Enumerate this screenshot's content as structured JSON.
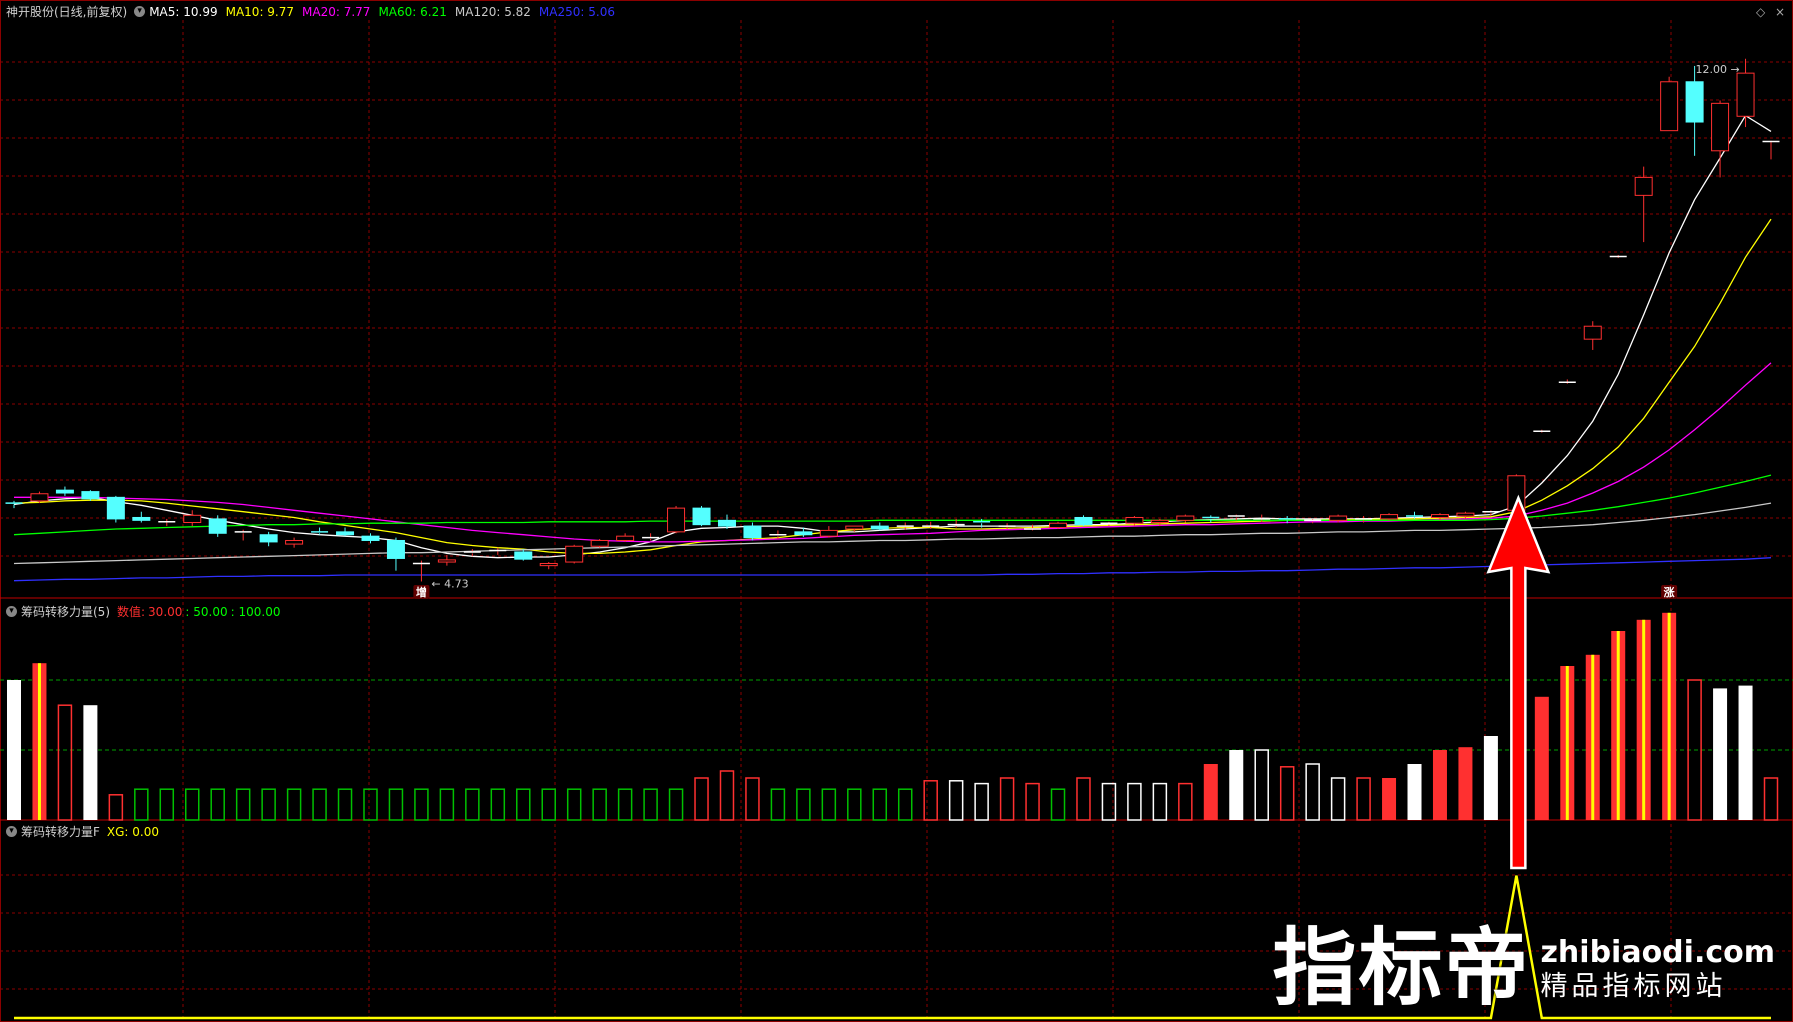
{
  "header": {
    "stock_label": "神开股份(日线,前复权)",
    "ma_items": [
      {
        "label": "MA5: 10.99",
        "color": "#ffffff"
      },
      {
        "label": "MA10: 9.77",
        "color": "#ffff00"
      },
      {
        "label": "MA20: 7.77",
        "color": "#ff00ff"
      },
      {
        "label": "MA60: 6.21",
        "color": "#00ff00"
      },
      {
        "label": "MA120: 5.82",
        "color": "#c8c8c8"
      },
      {
        "label": "MA250: 5.06",
        "color": "#3030ff"
      }
    ]
  },
  "panel2": {
    "title": "筹码转移力量(5)",
    "value_label": "数值:",
    "values": [
      {
        "text": "30.00",
        "color": "#ff3030"
      },
      {
        "text": ": 50.00",
        "color": "#00ff00"
      },
      {
        "text": ": 100.00",
        "color": "#00ff00"
      }
    ]
  },
  "panel3": {
    "title": "筹码转移力量F",
    "xg_label": "XG: 0.00"
  },
  "annotations": {
    "low_price": "4.73",
    "high_price": "12.00",
    "marker_left": "增",
    "marker_right": "涨"
  },
  "watermark": {
    "big": "指标帝",
    "domain": "zhibiaodi.com",
    "sub": "精品指标网站"
  },
  "colors": {
    "grid": "#8b0000",
    "up": "#ff3030",
    "down": "#54ffff",
    "bar_white": "#ffffff",
    "bar_green": "#00c000",
    "bar_yellow": "#ffff00",
    "arrow": "#ff0000"
  },
  "chart_data": [
    {
      "type": "candlestick",
      "title": "神开股份(日线,前复权)",
      "ylim": [
        4.5,
        12.4
      ],
      "ohlc": [
        [
          5.82,
          5.85,
          5.75,
          5.8
        ],
        [
          5.85,
          5.98,
          5.82,
          5.95
        ],
        [
          6.0,
          6.05,
          5.92,
          5.96
        ],
        [
          5.98,
          6.0,
          5.85,
          5.88
        ],
        [
          5.9,
          5.92,
          5.55,
          5.6
        ],
        [
          5.62,
          5.7,
          5.55,
          5.58
        ],
        [
          5.55,
          5.6,
          5.5,
          5.56
        ],
        [
          5.55,
          5.72,
          5.5,
          5.65
        ],
        [
          5.6,
          5.65,
          5.35,
          5.4
        ],
        [
          5.4,
          5.45,
          5.3,
          5.42
        ],
        [
          5.38,
          5.42,
          5.22,
          5.28
        ],
        [
          5.25,
          5.34,
          5.2,
          5.3
        ],
        [
          5.42,
          5.48,
          5.38,
          5.4
        ],
        [
          5.42,
          5.48,
          5.36,
          5.38
        ],
        [
          5.36,
          5.4,
          5.26,
          5.3
        ],
        [
          5.3,
          5.34,
          4.88,
          5.05
        ],
        [
          4.98,
          5.02,
          4.73,
          4.98
        ],
        [
          5.0,
          5.1,
          4.95,
          5.03
        ],
        [
          5.12,
          5.18,
          5.08,
          5.14
        ],
        [
          5.15,
          5.2,
          5.1,
          5.16
        ],
        [
          5.14,
          5.18,
          5.02,
          5.04
        ],
        [
          4.95,
          5.0,
          4.9,
          4.98
        ],
        [
          5.0,
          5.24,
          4.98,
          5.22
        ],
        [
          5.22,
          5.32,
          5.2,
          5.3
        ],
        [
          5.3,
          5.4,
          5.28,
          5.36
        ],
        [
          5.32,
          5.4,
          5.3,
          5.34
        ],
        [
          5.42,
          5.78,
          5.4,
          5.75
        ],
        [
          5.75,
          5.78,
          5.5,
          5.52
        ],
        [
          5.58,
          5.66,
          5.46,
          5.5
        ],
        [
          5.5,
          5.55,
          5.3,
          5.34
        ],
        [
          5.36,
          5.44,
          5.32,
          5.38
        ],
        [
          5.42,
          5.48,
          5.35,
          5.38
        ],
        [
          5.36,
          5.5,
          5.34,
          5.44
        ],
        [
          5.46,
          5.5,
          5.42,
          5.5
        ],
        [
          5.5,
          5.55,
          5.44,
          5.46
        ],
        [
          5.48,
          5.55,
          5.45,
          5.5
        ],
        [
          5.5,
          5.56,
          5.46,
          5.5
        ],
        [
          5.5,
          5.6,
          5.48,
          5.52
        ],
        [
          5.56,
          5.6,
          5.48,
          5.54
        ],
        [
          5.5,
          5.54,
          5.46,
          5.5
        ],
        [
          5.46,
          5.52,
          5.44,
          5.46
        ],
        [
          5.48,
          5.56,
          5.46,
          5.54
        ],
        [
          5.62,
          5.65,
          5.5,
          5.52
        ],
        [
          5.52,
          5.56,
          5.5,
          5.54
        ],
        [
          5.54,
          5.64,
          5.5,
          5.62
        ],
        [
          5.55,
          5.6,
          5.5,
          5.58
        ],
        [
          5.58,
          5.66,
          5.55,
          5.64
        ],
        [
          5.62,
          5.65,
          5.55,
          5.6
        ],
        [
          5.62,
          5.66,
          5.58,
          5.64
        ],
        [
          5.6,
          5.66,
          5.56,
          5.6
        ],
        [
          5.6,
          5.64,
          5.54,
          5.58
        ],
        [
          5.56,
          5.6,
          5.54,
          5.58
        ],
        [
          5.58,
          5.66,
          5.55,
          5.64
        ],
        [
          5.58,
          5.64,
          5.55,
          5.6
        ],
        [
          5.6,
          5.68,
          5.58,
          5.66
        ],
        [
          5.64,
          5.7,
          5.6,
          5.62
        ],
        [
          5.62,
          5.68,
          5.58,
          5.66
        ],
        [
          5.64,
          5.7,
          5.6,
          5.68
        ],
        [
          5.68,
          5.72,
          5.64,
          5.7
        ],
        [
          5.72,
          6.22,
          5.7,
          6.2
        ],
        [
          6.82,
          6.84,
          6.8,
          6.82
        ],
        [
          7.5,
          7.54,
          7.48,
          7.5
        ],
        [
          8.1,
          8.35,
          7.95,
          8.28
        ],
        [
          9.25,
          9.27,
          9.23,
          9.25
        ],
        [
          10.1,
          10.5,
          9.45,
          10.35
        ],
        [
          11.0,
          11.75,
          11.0,
          11.68
        ],
        [
          11.68,
          11.9,
          10.65,
          11.12
        ],
        [
          10.72,
          11.42,
          10.35,
          11.38
        ],
        [
          11.2,
          12.0,
          11.05,
          11.8
        ],
        [
          10.85,
          10.86,
          10.6,
          10.85
        ]
      ],
      "ma": {
        "MA5": [
          5.8,
          5.85,
          5.88,
          5.9,
          5.84,
          5.79,
          5.72,
          5.65,
          5.58,
          5.52,
          5.46,
          5.41,
          5.38,
          5.36,
          5.34,
          5.3,
          5.2,
          5.12,
          5.08,
          5.06,
          5.07,
          5.07,
          5.1,
          5.14,
          5.2,
          5.28,
          5.42,
          5.47,
          5.48,
          5.5,
          5.5,
          5.47,
          5.42,
          5.42,
          5.44,
          5.46,
          5.48,
          5.5,
          5.5,
          5.5,
          5.5,
          5.51,
          5.52,
          5.52,
          5.54,
          5.56,
          5.58,
          5.59,
          5.6,
          5.61,
          5.6,
          5.6,
          5.6,
          5.6,
          5.61,
          5.62,
          5.63,
          5.64,
          5.66,
          5.78,
          6.1,
          6.48,
          6.96,
          7.61,
          8.44,
          9.3,
          10.04,
          10.62,
          11.21,
          10.99
        ],
        "MA10": [
          5.82,
          5.83,
          5.85,
          5.86,
          5.86,
          5.85,
          5.82,
          5.78,
          5.74,
          5.7,
          5.66,
          5.62,
          5.56,
          5.51,
          5.46,
          5.41,
          5.34,
          5.27,
          5.23,
          5.2,
          5.18,
          5.14,
          5.12,
          5.12,
          5.14,
          5.17,
          5.23,
          5.28,
          5.3,
          5.32,
          5.34,
          5.38,
          5.42,
          5.45,
          5.47,
          5.48,
          5.48,
          5.46,
          5.46,
          5.47,
          5.48,
          5.49,
          5.5,
          5.51,
          5.52,
          5.53,
          5.54,
          5.55,
          5.56,
          5.57,
          5.58,
          5.58,
          5.59,
          5.59,
          5.6,
          5.6,
          5.61,
          5.62,
          5.63,
          5.7,
          5.86,
          6.06,
          6.3,
          6.6,
          7.0,
          7.5,
          8.0,
          8.6,
          9.24,
          9.77
        ],
        "MA20": [
          5.9,
          5.9,
          5.9,
          5.9,
          5.89,
          5.88,
          5.87,
          5.85,
          5.83,
          5.8,
          5.76,
          5.72,
          5.68,
          5.64,
          5.6,
          5.56,
          5.52,
          5.48,
          5.44,
          5.41,
          5.38,
          5.35,
          5.32,
          5.3,
          5.29,
          5.28,
          5.28,
          5.29,
          5.3,
          5.31,
          5.32,
          5.33,
          5.35,
          5.37,
          5.38,
          5.39,
          5.4,
          5.42,
          5.44,
          5.45,
          5.46,
          5.47,
          5.48,
          5.49,
          5.5,
          5.51,
          5.52,
          5.52,
          5.53,
          5.54,
          5.55,
          5.56,
          5.56,
          5.57,
          5.57,
          5.58,
          5.59,
          5.6,
          5.61,
          5.64,
          5.72,
          5.82,
          5.96,
          6.12,
          6.32,
          6.56,
          6.84,
          7.14,
          7.46,
          7.77
        ],
        "MA60": [
          5.38,
          5.4,
          5.42,
          5.44,
          5.46,
          5.47,
          5.48,
          5.49,
          5.5,
          5.51,
          5.52,
          5.52,
          5.53,
          5.53,
          5.54,
          5.54,
          5.54,
          5.55,
          5.55,
          5.55,
          5.55,
          5.56,
          5.56,
          5.56,
          5.56,
          5.57,
          5.57,
          5.57,
          5.57,
          5.57,
          5.57,
          5.57,
          5.57,
          5.57,
          5.58,
          5.58,
          5.58,
          5.58,
          5.58,
          5.58,
          5.58,
          5.58,
          5.58,
          5.58,
          5.58,
          5.58,
          5.58,
          5.58,
          5.58,
          5.58,
          5.58,
          5.58,
          5.58,
          5.58,
          5.58,
          5.58,
          5.58,
          5.58,
          5.59,
          5.61,
          5.64,
          5.68,
          5.72,
          5.77,
          5.83,
          5.89,
          5.96,
          6.04,
          6.12,
          6.21
        ],
        "MA120": [
          4.98,
          4.99,
          5.0,
          5.01,
          5.02,
          5.03,
          5.04,
          5.05,
          5.06,
          5.07,
          5.08,
          5.09,
          5.1,
          5.11,
          5.12,
          5.13,
          5.13,
          5.14,
          5.15,
          5.16,
          5.17,
          5.18,
          5.19,
          5.2,
          5.21,
          5.22,
          5.23,
          5.24,
          5.25,
          5.26,
          5.27,
          5.28,
          5.28,
          5.29,
          5.3,
          5.3,
          5.31,
          5.32,
          5.32,
          5.33,
          5.34,
          5.34,
          5.35,
          5.36,
          5.36,
          5.37,
          5.38,
          5.38,
          5.39,
          5.4,
          5.4,
          5.41,
          5.42,
          5.42,
          5.43,
          5.44,
          5.44,
          5.45,
          5.46,
          5.47,
          5.48,
          5.5,
          5.52,
          5.55,
          5.58,
          5.62,
          5.66,
          5.71,
          5.76,
          5.82
        ],
        "MA250": [
          4.74,
          4.75,
          4.76,
          4.76,
          4.77,
          4.78,
          4.78,
          4.79,
          4.8,
          4.8,
          4.81,
          4.81,
          4.81,
          4.82,
          4.82,
          4.82,
          4.82,
          4.82,
          4.82,
          4.82,
          4.82,
          4.82,
          4.82,
          4.82,
          4.82,
          4.82,
          4.82,
          4.82,
          4.82,
          4.82,
          4.82,
          4.82,
          4.82,
          4.82,
          4.82,
          4.82,
          4.82,
          4.82,
          4.82,
          4.83,
          4.83,
          4.84,
          4.84,
          4.85,
          4.85,
          4.86,
          4.86,
          4.87,
          4.87,
          4.88,
          4.88,
          4.89,
          4.9,
          4.9,
          4.91,
          4.92,
          4.92,
          4.93,
          4.94,
          4.95,
          4.96,
          4.97,
          4.98,
          4.99,
          5.0,
          5.01,
          5.02,
          5.03,
          5.04,
          5.06
        ]
      }
    },
    {
      "type": "bar",
      "title": "筹码转移力量(5)",
      "ylim": [
        0,
        140
      ],
      "levels": [
        30,
        50,
        100
      ],
      "values": [
        100,
        112,
        82,
        82,
        18,
        22,
        22,
        22,
        22,
        22,
        22,
        22,
        22,
        22,
        22,
        22,
        22,
        22,
        22,
        22,
        22,
        22,
        22,
        22,
        22,
        22,
        22,
        30,
        35,
        30,
        22,
        22,
        22,
        22,
        22,
        22,
        28,
        28,
        26,
        30,
        26,
        22,
        30,
        26,
        26,
        26,
        26,
        40,
        50,
        50,
        38,
        40,
        30,
        30,
        30,
        40,
        50,
        52,
        60,
        70,
        88,
        110,
        118,
        135,
        143,
        148,
        100,
        94,
        96,
        30
      ],
      "styles": [
        "w",
        "ry",
        "ro",
        "w",
        "ro",
        "g",
        "g",
        "g",
        "g",
        "g",
        "g",
        "g",
        "g",
        "g",
        "g",
        "g",
        "g",
        "g",
        "g",
        "g",
        "g",
        "g",
        "g",
        "g",
        "g",
        "g",
        "g",
        "ro",
        "ro",
        "ro",
        "g",
        "g",
        "g",
        "g",
        "g",
        "g",
        "ro",
        "wo",
        "wo",
        "ro",
        "ro",
        "g",
        "ro",
        "wo",
        "wo",
        "wo",
        "ro",
        "rf",
        "w",
        "wo",
        "ro",
        "wo",
        "wo",
        "ro",
        "rf",
        "w",
        "rf",
        "rf",
        "w",
        "e",
        "rf",
        "ry",
        "ry",
        "ry",
        "ry",
        "ry",
        "ro",
        "w",
        "w",
        "ro"
      ]
    },
    {
      "type": "line",
      "title": "筹码转移力量F",
      "series": [
        {
          "name": "XG",
          "values": [
            0,
            0,
            0,
            0,
            0,
            0,
            0,
            0,
            0,
            0,
            0,
            0,
            0,
            0,
            0,
            0,
            0,
            0,
            0,
            0,
            0,
            0,
            0,
            0,
            0,
            0,
            0,
            0,
            0,
            0,
            0,
            0,
            0,
            0,
            0,
            0,
            0,
            0,
            0,
            0,
            0,
            0,
            0,
            0,
            0,
            0,
            0,
            0,
            0,
            0,
            0,
            0,
            0,
            0,
            0,
            0,
            0,
            0,
            0,
            1,
            0,
            0,
            0,
            0,
            0,
            0,
            0,
            0,
            0,
            0
          ]
        }
      ],
      "ylim": [
        0,
        1.25
      ]
    }
  ]
}
